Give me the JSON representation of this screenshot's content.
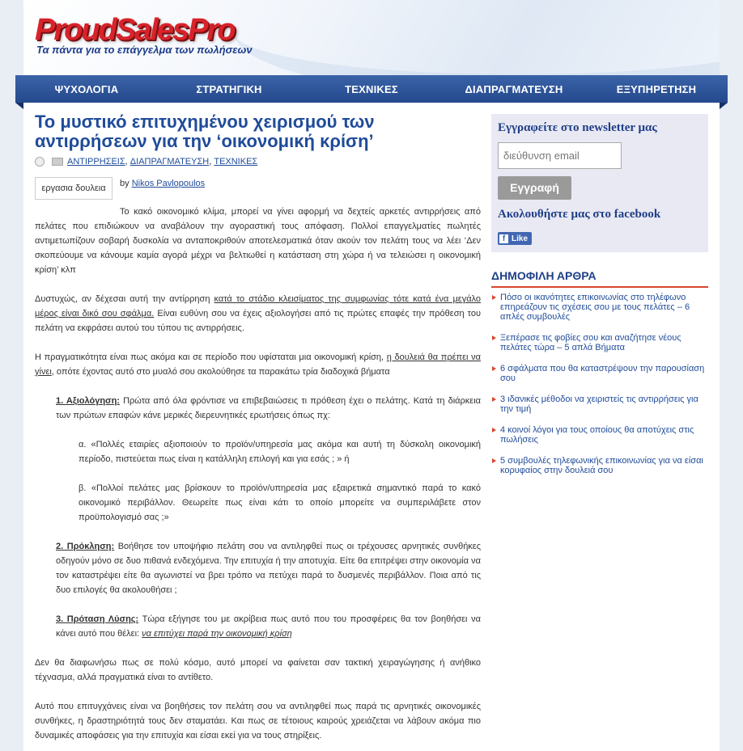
{
  "header": {
    "logo_text": "ProudSalesPro",
    "tagline": "Τα πάντα για το επάγγελμα των πωλήσεων"
  },
  "nav": [
    "ΨΥΧΟΛΟΓΙΑ",
    "ΣΤΡΑΤΗΓΙΚΗ",
    "ΤΕΧΝΙΚΕΣ",
    "ΔΙΑΠΡΑΓΜΑΤΕΥΣΗ",
    "ΕΞΥΠΗΡΕΤΗΣΗ"
  ],
  "post": {
    "title": "Το μυστικό επιτυχημένου χειρισμού των αντιρρήσεων για την ‘οικονομική κρίση’",
    "categories": [
      "ΑΝΤΙΡΡΗΣΕΙΣ",
      "ΔΙΑΠΡΑΓΜΑΤΕΥΣΗ",
      "ΤΕΧΝΙΚΕΣ"
    ],
    "thumb_alt": "εργασια δουλεια",
    "by": "by",
    "author": "Nikos Pavlopoulos",
    "p1": "Το κακό οικονομικό κλίμα, μπορεί να γίνει αφορμή να δεχτείς αρκετές αντιρρήσεις από πελάτες που επιδιώκουν να αναβάλουν την αγοραστική τους απόφαση. Πολλοί επαγγελματίες πωλητές αντιμετωπίζουν σοβαρή δυσκολία να ανταποκριθούν αποτελεσματικά όταν ακούν τον πελάτη τους να λέει ‘Δεν σκοπεύουμε να κάνουμε καμία αγορά μέχρι να βελτιωθεί η κατάσταση στη χώρα ή να τελειώσει η οικονομική κρίση’ κλπ",
    "p2_a": "Δυστυχώς, αν δέχεσαι αυτή την αντίρρηση ",
    "p2_u": "κατά το στάδιο κλεισίματος της συμφωνίας τότε κατά ένα μεγάλο μέρος είναι δικό σου σφάλμα.",
    "p2_b": " Είναι ευθύνη σου να έχεις αξιολογήσει από τις πρώτες επαφές την πρόθεση του πελάτη να εκφράσει αυτού του τύπου τις αντιρρήσεις.",
    "p3_a": "Η πραγματικότητα είναι πως ακόμα και σε περίοδο που υφίσταται μια οικονομική κρίση, ",
    "p3_u": "η δουλειά θα πρέπει να γίνει",
    "p3_b": ", οπότε έχοντας αυτό στο μυαλό σου ακολούθησε τα παρακάτω τρία διαδοχικά βήματα",
    "s1_h": "1. Αξιολόγηση:",
    "s1_t": " Πρώτα από όλα φρόντισε να επιβεβαιώσεις τι πρόθεση έχει ο πελάτης. Κατά τη διάρκεια των πρώτων επαφών κάνε μερικές διερευνητικές ερωτήσεις όπως πχ:",
    "s1_a": "α. «Πολλές εταιρίες αξιοποιούν το προϊόν/υπηρεσία μας ακόμα και αυτή τη δύσκολη οικονομική περίοδο, πιστεύεται πως είναι η κατάλληλη επιλογή και για εσάς ; » ή",
    "s1_b": "β. «Πολλοί πελάτες μας βρίσκουν το προϊόν/υπηρεσία μας εξαιρετικά σημαντικό παρά το κακό οικονομικό περιβάλλον. Θεωρείτε πως είναι κάτι το οποίο μπορείτε να συμπεριλάβετε στον προϋπολογισμό σας ;»",
    "s2_h": "2. Πρόκληση:",
    "s2_t": " Βοήθησε τον υποψήφιο πελάτη σου να αντιληφθεί πως οι τρέχουσες αρνητικές συνθήκες οδηγούν μόνο σε δυο πιθανά ενδεχόμενα. Την επιτυχία ή την αποτυχία. Είτε θα επιτρέψει στην οικονομία να τον καταστρέψει είτε θα αγωνιστεί να βρει τρόπο να πετύχει παρά το δυσμενές περιβάλλον. Ποια από τις δυο επιλογές θα ακολουθήσει ;",
    "s3_h": "3. Πρόταση Λύσης:",
    "s3_t": " Τώρα εξήγησε του με ακρίβεια πως αυτό που του προσφέρεις θα τον βοηθήσει να κάνει αυτό που θέλει: ",
    "s3_u": "να επιτύχει παρά την οικονομική κρίση",
    "p4": "Δεν θα διαφωνήσω πως σε πολύ κόσμο, αυτό μπορεί να φαίνεται σαν τακτική χειραγώγησης ή ανήθικο τέχνασμα, αλλά πραγματικά είναι το αντίθετο.",
    "p5": "Αυτό που επιτυγχάνεις είναι να βοηθήσεις τον πελάτη σου να αντιληφθεί πως παρά τις αρνητικές οικονομικές συνθήκες, η δραστηριότητά τους δεν σταματάει. Και πως σε τέτοιους καιρούς χρειάζεται να λάβουν ακόμα πιο δυναμικές αποφάσεις για την επιτυχία και είσαι εκεί για να τους στηρίξεις."
  },
  "sidebar": {
    "newsletter_title": "Εγγραφείτε στο newsletter μας",
    "email_placeholder": "διεύθυνση email",
    "subscribe_label": "Εγγραφή",
    "facebook_title": "Ακολουθήστε μας στο facebook",
    "like_label": "Like",
    "popular_title": "ΔΗΜΟΦΙΛΗ ΑΡΘΡΑ",
    "popular": [
      "Πόσο οι ικανότητες επικοινωνίας στο τηλέφωνο επηρεάζουν τις σχέσεις σου με τους πελάτες – 6 απλές συμβουλές",
      "Ξεπέρασε τις φοβίες σου και αναζήτησε νέους πελάτες τώρα – 5 απλά Βήματα",
      "6 σφάλματα που θα καταστρέψουν την παρουσίαση σου",
      "3 ιδανικές μέθοδοι να χειριστείς τις αντιρρήσεις για την τιμή",
      "4 κοινοί λόγοι για τους οποίους θα αποτύχεις στις πωλήσεις",
      "5 συμβουλές τηλεφωνικής επικοινωνίας για να είσαι κορυφαίος στην δουλειά σου"
    ]
  },
  "colors": {
    "brand_red": "#d8232a",
    "nav_blue": "#2d539a",
    "link_blue": "#1f4b9a",
    "accent_red": "#d9452f"
  }
}
